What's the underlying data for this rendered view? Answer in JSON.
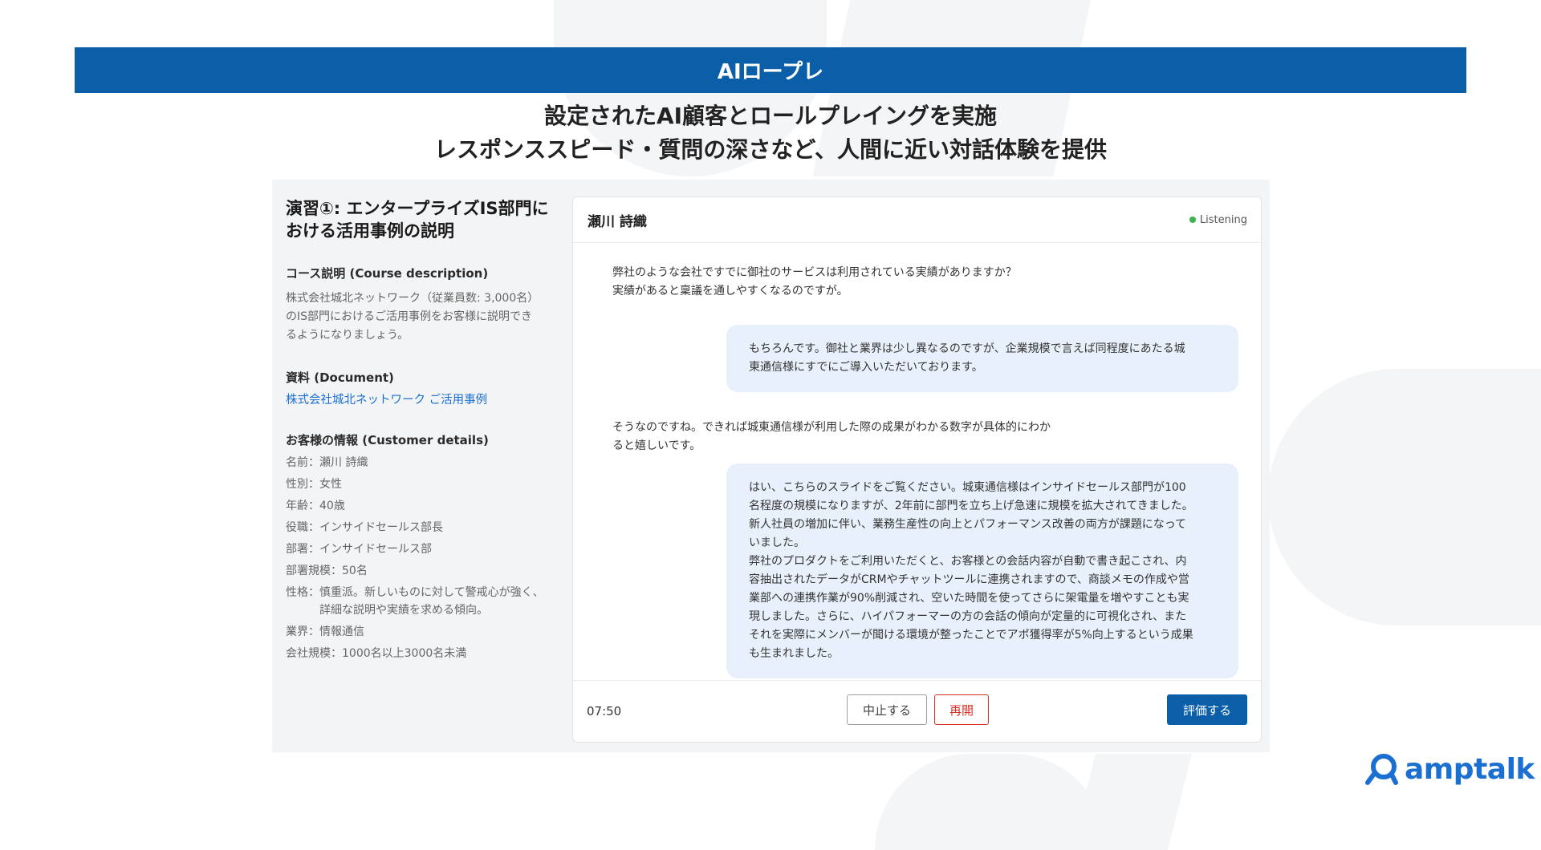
{
  "banner": {
    "title": "AIロープレ"
  },
  "subtitle": {
    "line1": "設定されたAI顧客とロールプレイングを実施",
    "line2": "レスポンススピード・質問の深さなど、人間に近い対話体験を提供"
  },
  "course": {
    "title_line1": "演習①: エンタープライズIS部門に",
    "title_line2": "おける活用事例の説明",
    "description_heading": "コース説明 (Course description)",
    "description_lines": [
      "株式会社城北ネットワーク（従業員数: 3,000名）",
      "のIS部門におけるご活用事例をお客様に説明でき",
      "るようになりましょう。"
    ],
    "document_heading": "資料 (Document)",
    "document_link": "株式会社城北ネットワーク ご活用事例",
    "customer_heading": "お客様の情報 (Customer details)",
    "customer": [
      {
        "k": "名前：",
        "v": "瀬川 詩織"
      },
      {
        "k": "性別：",
        "v": "女性"
      },
      {
        "k": "年齢：",
        "v": "40歳"
      },
      {
        "k": "役職：",
        "v": "インサイドセールス部長"
      },
      {
        "k": "部署：",
        "v": "インサイドセールス部"
      },
      {
        "k": "部署規模：",
        "v": "50名"
      },
      {
        "k": "性格：",
        "v1": "慎重派。新しいものに対して警戒心が強く、",
        "v2": "詳細な説明や実績を求める傾向。"
      },
      {
        "k": "業界：",
        "v": "情報通信"
      },
      {
        "k": "会社規模：",
        "v": "1000名以上3000名未満"
      }
    ]
  },
  "chat": {
    "name": "瀬川 詩織",
    "status": "Listening",
    "status_color": "#3bb54a",
    "messages": [
      {
        "role": "ai",
        "lines": [
          "弊社のような会社ですでに御社のサービスは利用されている実績がありますか？",
          "実績があると稟議を通しやすくなるのですが。"
        ]
      },
      {
        "role": "user",
        "lines": [
          "もちろんです。御社と業界は少し異なるのですが、企業規模で言えば同程度にあたる城",
          "東通信様にすでにご導入いただいております。"
        ]
      },
      {
        "role": "ai",
        "lines": [
          "そうなのですね。できれば城東通信様が利用した際の成果がわかる数字が具体的にわか",
          "ると嬉しいです。"
        ]
      },
      {
        "role": "user",
        "lines": [
          "はい、こちらのスライドをご覧ください。城東通信様はインサイドセールス部門が100",
          "名程度の規模になりますが、2年前に部門を立ち上げ急速に規模を拡大されてきました。",
          "新人社員の増加に伴い、業務生産性の向上とパフォーマンス改善の両方が課題になって",
          "いました。",
          "弊社のプロダクトをご利用いただくと、お客様との会話内容が自動で書き起こされ、内",
          "容抽出されたデータがCRMやチャットツールに連携されますので、商談メモの作成や営",
          "業部への連携作業が90%削減され、空いた時間を使ってさらに架電量を増やすことも実",
          "現しました。さらに、ハイパフォーマーの方の会話の傾向が定量的に可視化され、また",
          "それを実際にメンバーが聞ける環境が整ったことでアポ獲得率が5%向上するという成果",
          "も生まれました。"
        ]
      }
    ],
    "timer": "07:50",
    "stop_label": "中止する",
    "resume_label": "再開",
    "evaluate_label": "評価する"
  },
  "brand": {
    "name": "amptalk",
    "color": "#1a6fd1",
    "accent": "#0b5ea8"
  }
}
